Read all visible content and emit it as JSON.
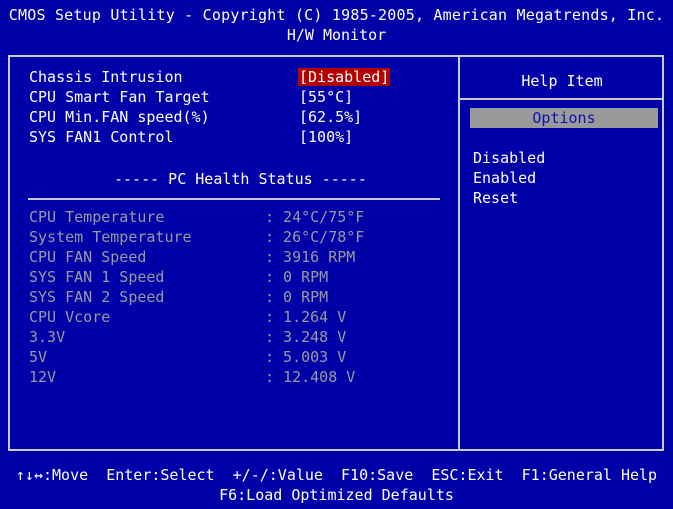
{
  "header": {
    "title": "CMOS Setup Utility - Copyright (C) 1985-2005, American Megatrends, Inc.",
    "subtitle": "H/W Monitor"
  },
  "settings": [
    {
      "label": "Chassis Intrusion",
      "value": "[Disabled]"
    },
    {
      "label": "CPU Smart Fan Target",
      "value": "[55°C]"
    },
    {
      "label": "CPU Min.FAN speed(%)",
      "value": "[62.5%]"
    },
    {
      "label": "SYS FAN1 Control",
      "value": "[100%]"
    }
  ],
  "section_title": "----- PC Health Status -----",
  "health": [
    {
      "label": "CPU Temperature",
      "value": ": 24°C/75°F"
    },
    {
      "label": "System Temperature",
      "value": ": 26°C/78°F"
    },
    {
      "label": "CPU FAN Speed",
      "value": ": 3916 RPM"
    },
    {
      "label": "SYS FAN 1 Speed",
      "value": ": 0 RPM"
    },
    {
      "label": "SYS FAN 2 Speed",
      "value": ": 0 RPM"
    },
    {
      "label": "CPU Vcore",
      "value": ": 1.264 V"
    },
    {
      "label": "3.3V",
      "value": ": 3.248 V"
    },
    {
      "label": "5V",
      "value": ": 5.003 V"
    },
    {
      "label": "12V",
      "value": ": 12.408 V"
    }
  ],
  "help": {
    "title": "Help Item",
    "options_label": "Options",
    "options": [
      "Disabled",
      "Enabled",
      "Reset"
    ]
  },
  "footer": {
    "line1": "↑↓↔:Move  Enter:Select  +/-/:Value  F10:Save  ESC:Exit  F1:General Help",
    "line2": "F6:Load Optimized Defaults"
  },
  "colors": {
    "background": "#0000a8",
    "selected_highlight": "#b30000",
    "inactive_text": "#9a9a9a",
    "options_bar": "#9a9a9a"
  }
}
